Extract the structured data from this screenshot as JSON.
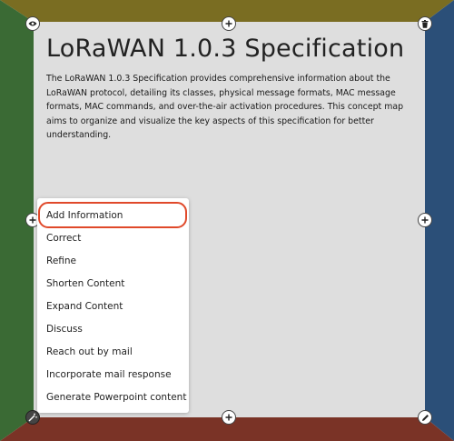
{
  "colors": {
    "top_frame": "#7a6d22",
    "left_frame": "#3a6a34",
    "right_frame": "#2b4f78",
    "bottom_frame": "#7a3326",
    "card_bg": "#dedede",
    "highlight": "#e0492a"
  },
  "card": {
    "title": "LoRaWAN 1.0.3 Specification",
    "description": "The LoRaWAN 1.0.3 Specification provides comprehensive information about the LoRaWAN protocol, detailing its classes, physical message formats, MAC message formats, MAC commands, and over-the-air activation procedures. This concept map aims to organize and visualize the key aspects of this specification for better understanding."
  },
  "controls": {
    "top_left_icon": "eye-icon",
    "top_center_icon": "plus-icon",
    "top_right_icon": "trash-icon",
    "left_center_icon": "plus-icon",
    "right_center_icon": "plus-icon",
    "bottom_left_icon": "magic-wand-icon",
    "bottom_center_icon": "plus-icon",
    "bottom_right_icon": "pencil-icon"
  },
  "menu": {
    "items": [
      "Add Information",
      "Correct",
      "Refine",
      "Shorten Content",
      "Expand Content",
      "Discuss",
      "Reach out by mail",
      "Incorporate mail response",
      "Generate Powerpoint content"
    ],
    "highlighted_item": "Add Information"
  }
}
